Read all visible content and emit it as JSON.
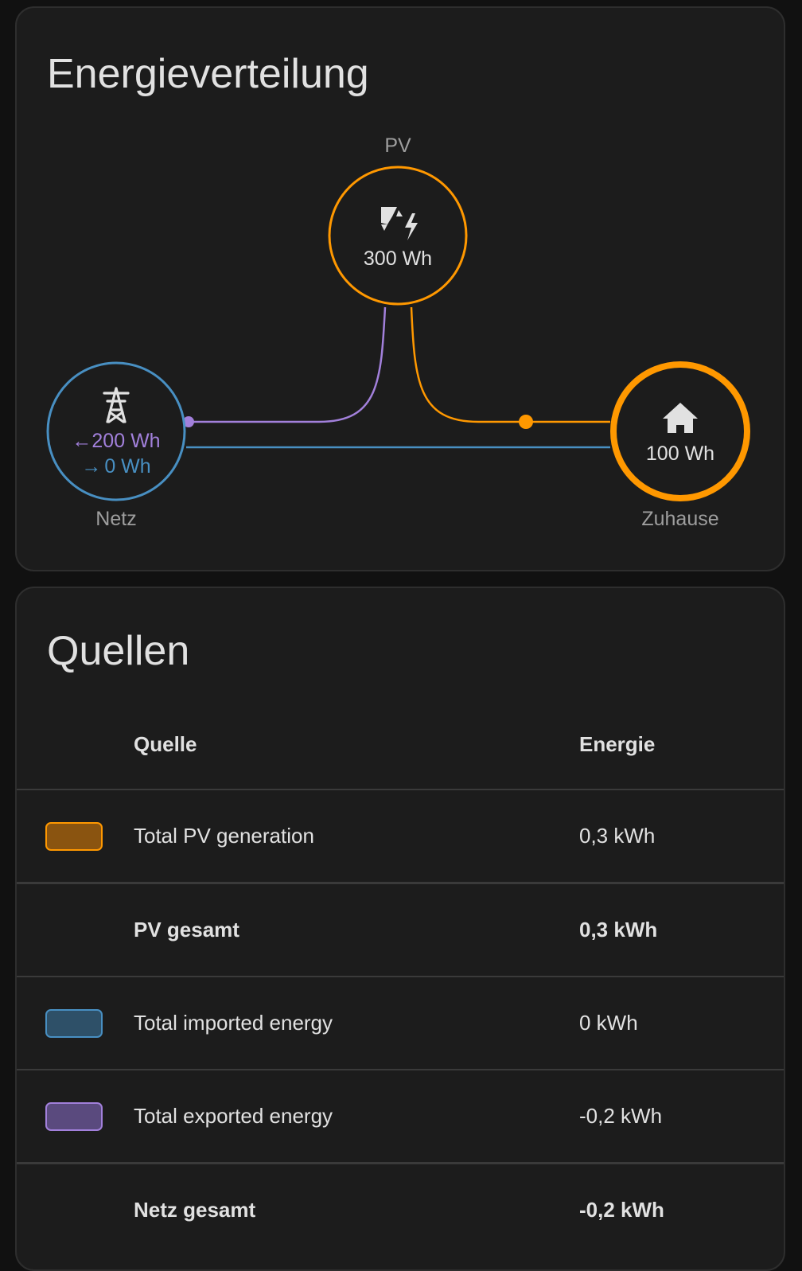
{
  "flow_card": {
    "title": "Energieverteilung",
    "pv": {
      "label": "PV",
      "value": "300 Wh",
      "icon": "solar-power-icon",
      "color": "#ff9800"
    },
    "grid": {
      "label": "Netz",
      "import_value": "200 Wh",
      "export_value": "0 Wh",
      "icon": "transmission-tower-icon",
      "import_arrow": "←",
      "export_arrow": "→",
      "color": "#488fc2",
      "import_color": "#a280db"
    },
    "home": {
      "label": "Zuhause",
      "value": "100 Wh",
      "icon": "home-icon",
      "color": "#ff9800"
    }
  },
  "sources_card": {
    "title": "Quellen",
    "columns": {
      "source": "Quelle",
      "energy": "Energie"
    },
    "rows": [
      {
        "label": "Total PV generation",
        "value": "0,3 kWh",
        "swatch_fill": "#8a5410",
        "swatch_border": "#ff9800",
        "total": false
      },
      {
        "label": "PV gesamt",
        "value": "0,3 kWh",
        "total": true
      },
      {
        "label": "Total imported energy",
        "value": "0 kWh",
        "swatch_fill": "#2e5068",
        "swatch_border": "#488fc2",
        "total": false
      },
      {
        "label": "Total exported energy",
        "value": "-0,2 kWh",
        "swatch_fill": "#5a4a7e",
        "swatch_border": "#a280db",
        "total": false
      },
      {
        "label": "Netz gesamt",
        "value": "-0,2 kWh",
        "total": true
      }
    ]
  }
}
